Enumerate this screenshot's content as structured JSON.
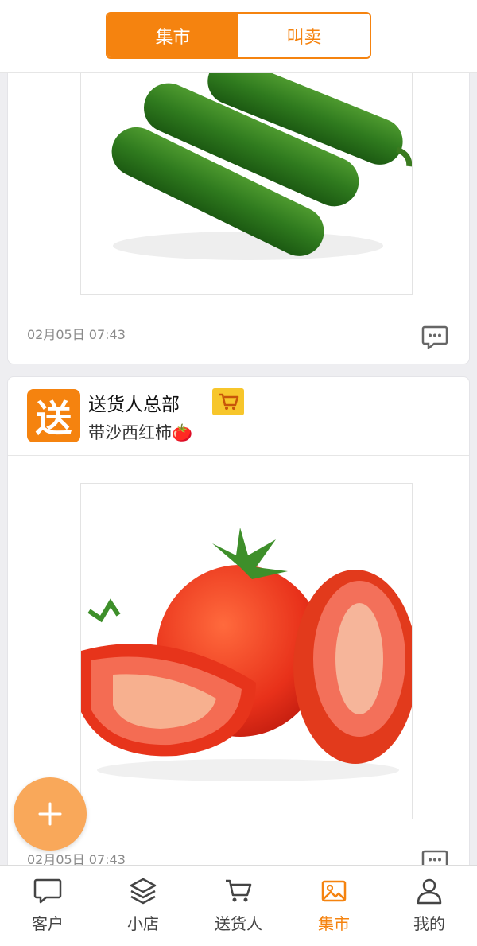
{
  "header": {
    "tabs": [
      {
        "label": "集市",
        "active": true
      },
      {
        "label": "叫卖",
        "active": false
      }
    ]
  },
  "feed": {
    "posts": [
      {
        "image": "cucumber-photo",
        "timestamp": "02月05日 07:43"
      },
      {
        "author": "送货人总部",
        "avatar_text": "送",
        "text": "带沙西红柿🍅",
        "image": "tomato-photo",
        "timestamp": "02月05日 07:43"
      }
    ]
  },
  "tabbar": {
    "items": [
      {
        "label": "客户",
        "icon": "chat-bubble-icon",
        "active": false
      },
      {
        "label": "小店",
        "icon": "layers-icon",
        "active": false
      },
      {
        "label": "送货人",
        "icon": "cart-icon",
        "active": false
      },
      {
        "label": "集市",
        "icon": "image-icon",
        "active": true
      },
      {
        "label": "我的",
        "icon": "person-icon",
        "active": false
      }
    ]
  },
  "colors": {
    "accent": "#f5830f",
    "fab": "#f9a85a",
    "badge": "#f7c62b"
  }
}
